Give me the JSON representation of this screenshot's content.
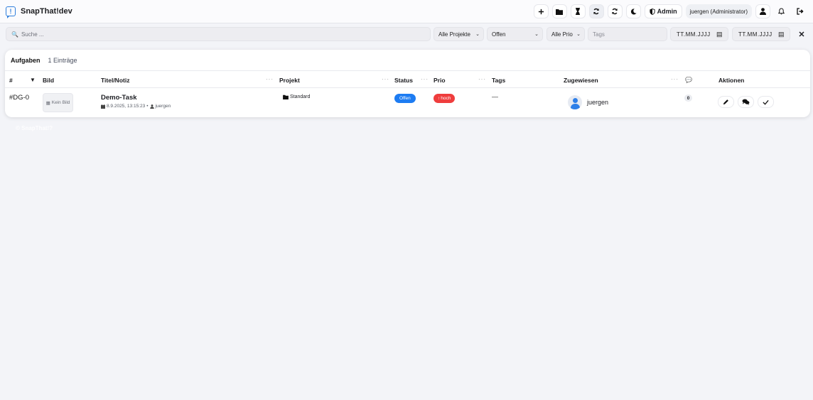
{
  "app": {
    "name": "SnapThat!dev",
    "logo_glyph": "!"
  },
  "header": {
    "icons": [
      "plus-icon",
      "folder-icon",
      "hourglass-icon",
      "sync-icon",
      "refresh-icon",
      "moon-icon"
    ],
    "admin_label": "Admin",
    "user_label": "juergen (Administrator)"
  },
  "filters": {
    "search_placeholder": "Suche ...",
    "project": "Alle Projekte",
    "status": "Offen",
    "prio": "Alle Prio",
    "tags_placeholder": "Tags",
    "date_from": "TT.MM.JJJJ",
    "date_to": "TT.MM.JJJJ"
  },
  "card": {
    "title": "Aufgaben",
    "count": "1 Einträge"
  },
  "columns": {
    "id": "#",
    "image": "Bild",
    "title": "Titel/Notiz",
    "project": "Projekt",
    "status": "Status",
    "prio": "Prio",
    "tags": "Tags",
    "assignee": "Zugewiesen",
    "actions": "Aktionen"
  },
  "row": {
    "id": "#DG-0",
    "image_label": "Kein Bild",
    "title": "Demo-Task",
    "date": "8.9.2025, 13:15:23",
    "separator": "•",
    "author": "juergen",
    "project": "Standard",
    "status": "Offen",
    "prio": "hoch",
    "tags": "—",
    "assignee": "juergen",
    "comments": "0"
  },
  "footer_ghost": "© SnapThat!?",
  "colors": {
    "accent": "#2f7fdc",
    "status_open": "#1d7cf2",
    "prio_high": "#ef3d3d",
    "background": "#f3f4f8"
  }
}
